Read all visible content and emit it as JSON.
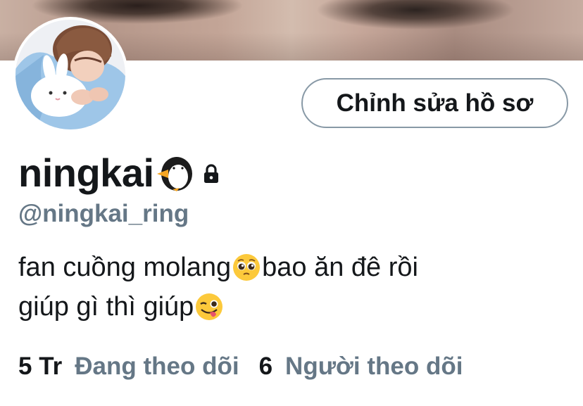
{
  "profile": {
    "display_name": "ningkai",
    "handle": "@ningkai_ring",
    "edit_button_label": "Chỉnh sửa hồ sơ",
    "name_emoji": "penguin",
    "protected": true
  },
  "bio": {
    "line1_part1": "fan cuồng molang",
    "emoji1": "pleading-face",
    "line1_part2": "bao ăn đê rồi",
    "line2_part1": "giúp gì thì giúp",
    "emoji2": "winking-face-with-tongue"
  },
  "stats": {
    "following_count": "5 Tr",
    "following_label": "Đang theo dõi",
    "followers_count": "6",
    "followers_label": "Người theo dõi"
  },
  "colors": {
    "primary_text": "#14171a",
    "secondary_text": "#657786",
    "button_border": "#8899a6"
  }
}
